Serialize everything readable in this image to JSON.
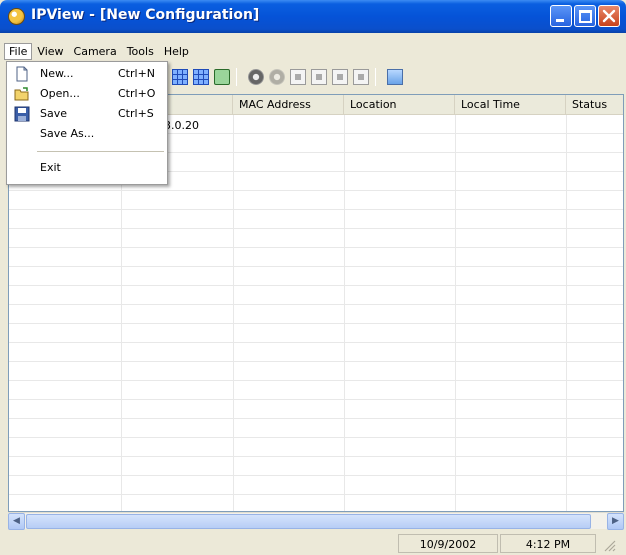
{
  "window": {
    "title": "IPView - [New Configuration]"
  },
  "menubar": {
    "items": [
      {
        "label": "File"
      },
      {
        "label": "View"
      },
      {
        "label": "Camera"
      },
      {
        "label": "Tools"
      },
      {
        "label": "Help"
      }
    ]
  },
  "file_menu": {
    "new": {
      "label": "New...",
      "shortcut": "Ctrl+N"
    },
    "open": {
      "label": "Open...",
      "shortcut": "Ctrl+O"
    },
    "save": {
      "label": "Save",
      "shortcut": "Ctrl+S"
    },
    "save_as": {
      "label": "Save As..."
    },
    "exit": {
      "label": "Exit"
    }
  },
  "list": {
    "columns": [
      {
        "label": ""
      },
      {
        "label": "ess"
      },
      {
        "label": "MAC Address"
      },
      {
        "label": "Location"
      },
      {
        "label": "Local Time"
      },
      {
        "label": "Status"
      }
    ],
    "rows": [
      {
        "ip": "3.0.20"
      }
    ]
  },
  "statusbar": {
    "date": "10/9/2002",
    "time": "4:12 PM"
  },
  "colors": {
    "titlebar": "#0553d8",
    "menu_bg": "#ece9d8",
    "list_border": "#7f9db9"
  }
}
